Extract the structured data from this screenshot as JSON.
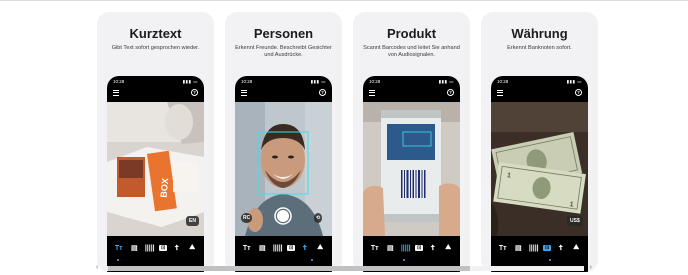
{
  "cards": [
    {
      "title": "Kurztext",
      "subtitle": "Gibt Text sofort gesprochen wieder.",
      "status_time": "10:28",
      "badge": "EN",
      "active_tool": 0
    },
    {
      "title": "Personen",
      "subtitle": "Erkennt Freunde. Beschreibt Gesichter und Ausdrücke.",
      "status_time": "10:28",
      "badge": "",
      "active_tool": 5
    },
    {
      "title": "Produkt",
      "subtitle": "Scannt Barcodes und leitet Sie anhand von Audiosignalen.",
      "status_time": "10:28",
      "badge": "",
      "active_tool": 2
    },
    {
      "title": "Währung",
      "subtitle": "Erkennt Banknoten sofort.",
      "status_time": "10:28",
      "badge": "US$",
      "active_tool": 3
    }
  ],
  "toolbar_icons": [
    "text-icon",
    "document-icon",
    "barcode-icon",
    "currency-icon",
    "person-icon",
    "scene-icon"
  ],
  "toolbar_glyphs": [
    "Tт",
    "▤",
    "|||||",
    "⊡",
    "☦",
    "⛰"
  ],
  "help_glyph": "?",
  "card2_left_badge": "RC",
  "scroll_left_arrow": "‹",
  "scroll_right_arrow": "›",
  "colors": {
    "accent": "#3da9f5",
    "card_bg": "#f2f2f4",
    "phone_bg": "#000000"
  }
}
